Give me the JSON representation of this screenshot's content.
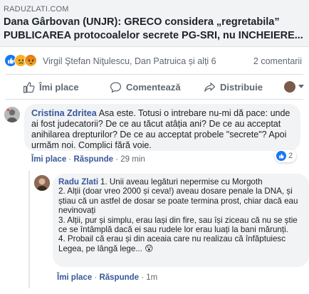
{
  "link": {
    "domain": "RADUZLATI.COM",
    "headline_line1": "Dana Gârbovan (UNJR): GRECO considera „regretabila”",
    "headline_line2": "PUBLICAREA protocoalelor secrete PG-SRI, nu INCHEIERE..."
  },
  "reactions": {
    "icons": [
      "like-icon",
      "sad-icon",
      "angry-icon"
    ],
    "names": "Virgil Ştefan Niţulescu, Dan Patruica și alți 6",
    "comments_count": "2 comentarii"
  },
  "actions": {
    "like": "Îmi place",
    "comment": "Comentează",
    "share": "Distribuie"
  },
  "comments": [
    {
      "author": "Cristina Zdritea",
      "text": "Asa este. Totusi o intrebare nu-mi dă pace: unde ai fost judecatorii? De ce au tăcut atâția ani? De ce au acceptat anihilarea drepturilor? De ce au acceptat probele \"secrete\"? Apoi urmăm noi. Complici fără voie.",
      "like_label": "Îmi place",
      "reply_label": "Răspunde",
      "time": "29 min",
      "reaction_count": "2"
    },
    {
      "author": "Radu Zlati",
      "lines": [
        "1. Unii aveau legături nepermise cu Morgoth",
        "2. Alții (doar vreo 2000 și ceva!) aveau dosare penale la DNA, și știau că un astfel de dosar se poate termina prost, chiar dacă eau nevinovați",
        "3. Alții, pur și simplu, erau lași din fire, sau își ziceau că nu se știe ce se întâmplă dacă ei sau rudele lor erau luați la bani mărunți.",
        "4. Probail că erau și din aceaia care nu realizau că înfăptuiesc Legea, pe lângă lege... 😮"
      ],
      "like_label": "Îmi place",
      "reply_label": "Răspunde",
      "time": "1m"
    }
  ],
  "colors": {
    "link_blue": "#385898",
    "like_blue": "#1877f2",
    "muted": "#606770",
    "bubble_bg": "#f2f3f5"
  }
}
